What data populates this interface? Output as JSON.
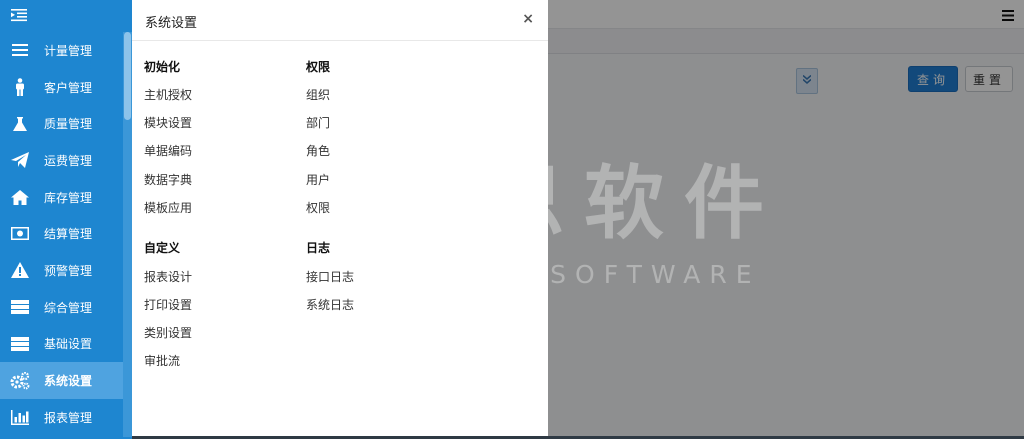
{
  "sidebar": {
    "items": [
      {
        "label": "计量管理",
        "icon": "list-icon"
      },
      {
        "label": "客户管理",
        "icon": "person-icon"
      },
      {
        "label": "质量管理",
        "icon": "flask-icon"
      },
      {
        "label": "运费管理",
        "icon": "paper-plane-icon"
      },
      {
        "label": "库存管理",
        "icon": "home-icon"
      },
      {
        "label": "结算管理",
        "icon": "money-icon"
      },
      {
        "label": "预警管理",
        "icon": "warning-icon"
      },
      {
        "label": "综合管理",
        "icon": "server-icon"
      },
      {
        "label": "基础设置",
        "icon": "server-icon"
      },
      {
        "label": "系统设置",
        "icon": "gears-icon"
      },
      {
        "label": "报表管理",
        "icon": "bar-chart-icon"
      }
    ],
    "active_index": 9
  },
  "toolbar": {
    "query_label": "查询",
    "reset_label": "重置"
  },
  "watermark": {
    "cn": "易思软件",
    "en": "EOSINE SOFTWARE"
  },
  "panel": {
    "title": "系统设置",
    "close_glyph": "×",
    "groups": [
      {
        "title": "初始化",
        "links": [
          "主机授权",
          "模块设置",
          "单据编码",
          "数据字典",
          "模板应用"
        ]
      },
      {
        "title": "权限",
        "links": [
          "组织",
          "部门",
          "角色",
          "用户",
          "权限"
        ]
      },
      {
        "title": "自定义",
        "links": [
          "报表设计",
          "打印设置",
          "类别设置",
          "审批流"
        ]
      },
      {
        "title": "日志",
        "links": [
          "接口日志",
          "系统日志"
        ]
      }
    ]
  }
}
